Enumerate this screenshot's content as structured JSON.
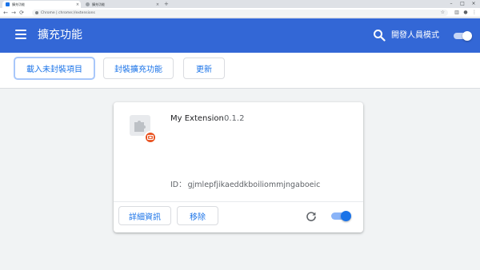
{
  "browser": {
    "tabs": [
      {
        "title": "擴充功能",
        "active": true
      },
      {
        "title": "擴充功能",
        "active": false
      }
    ],
    "address": "Chrome | chrome://extensions"
  },
  "header": {
    "title": "擴充功能",
    "developer_mode_label": "開發人員模式",
    "developer_mode_enabled": true
  },
  "actions": {
    "load_unpacked": "載入未封裝項目",
    "pack_extension": "封裝擴充功能",
    "update": "更新"
  },
  "extension": {
    "name": "My Extension",
    "version": "0.1.2",
    "id_label": "ID：",
    "id_value": "gjmlepfjikaeddkboiliommjngaboeic",
    "details_label": "詳細資訊",
    "remove_label": "移除",
    "enabled": true
  },
  "colors": {
    "header_bg": "#3367d6",
    "accent": "#1a73e8",
    "badge": "#e8501d"
  }
}
